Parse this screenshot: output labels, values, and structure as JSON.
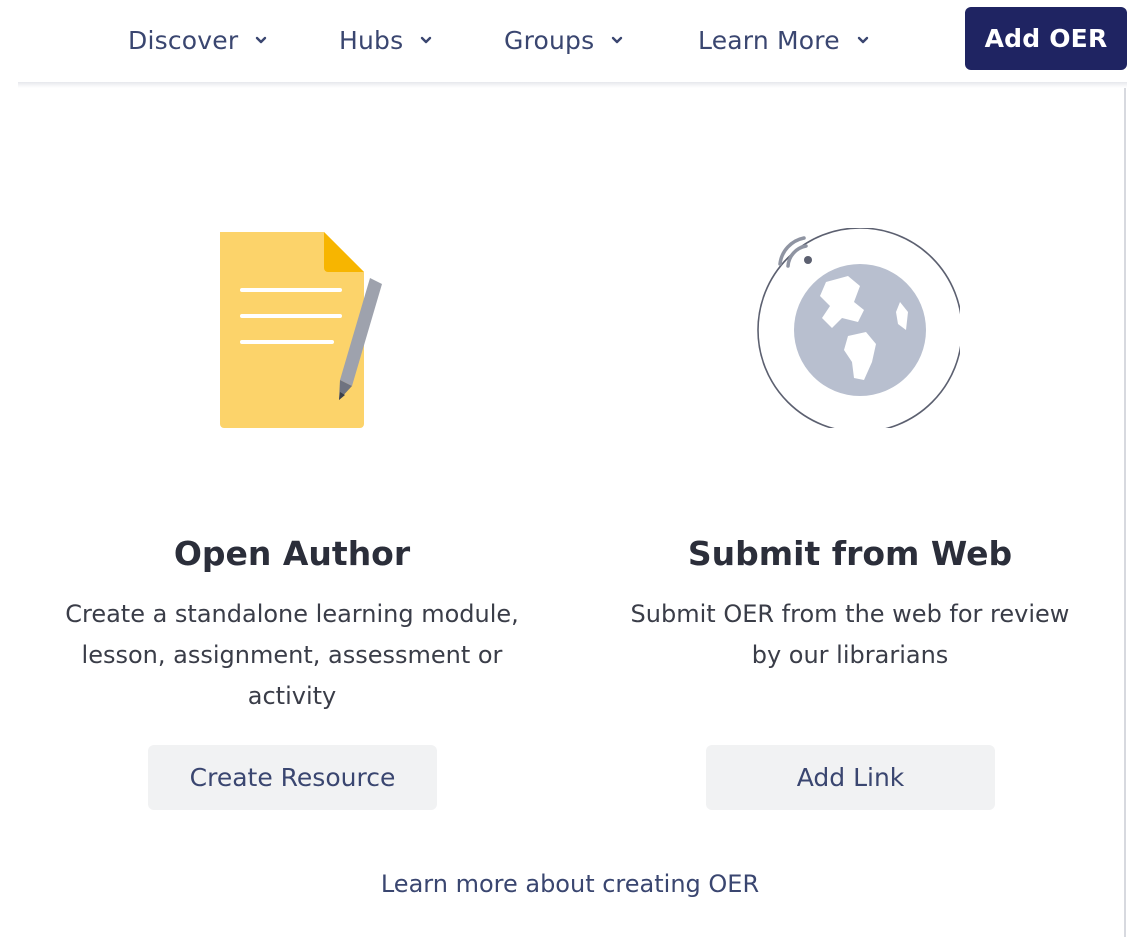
{
  "nav": {
    "items": [
      {
        "label": "Discover"
      },
      {
        "label": "Hubs"
      },
      {
        "label": "Groups"
      },
      {
        "label": "Learn More"
      }
    ],
    "add_button": "Add OER"
  },
  "options": [
    {
      "title": "Open Author",
      "description": "Create a standalone learning module, lesson, assignment, assessment or activity",
      "button": "Create Resource",
      "icon": "document-pencil-icon"
    },
    {
      "title": "Submit from Web",
      "description": "Submit OER from the web for review by our librarians",
      "button": "Add Link",
      "icon": "globe-icon"
    }
  ],
  "footer_link": "Learn more about creating OER",
  "colors": {
    "primary": "#1f2462",
    "nav_text": "#3a4670",
    "document_yellow": "#fcd36a",
    "globe_gray": "#b8bfcf"
  }
}
